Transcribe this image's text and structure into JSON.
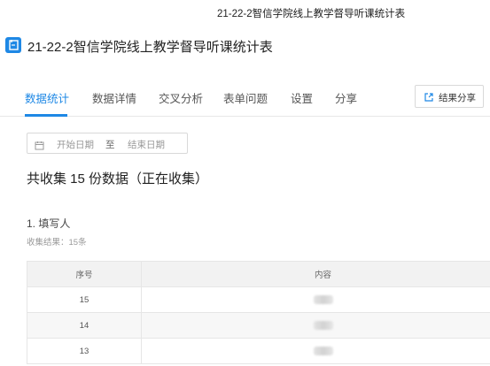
{
  "window": {
    "title": "21-22-2智信学院线上教学督导听课统计表"
  },
  "header": {
    "title": "21-22-2智信学院线上教学督导听课统计表",
    "icon": "form-icon"
  },
  "nav": {
    "tabs": [
      {
        "label": "数据统计",
        "active": true
      },
      {
        "label": "数据详情",
        "active": false
      },
      {
        "label": "交叉分析",
        "active": false
      },
      {
        "label": "表单问题",
        "active": false
      },
      {
        "label": "设置",
        "active": false
      },
      {
        "label": "分享",
        "active": false
      }
    ],
    "share_button": {
      "label": "结果分享",
      "icon": "share-icon"
    }
  },
  "filter": {
    "start_placeholder": "开始日期",
    "separator": "至",
    "end_placeholder": "结束日期",
    "icon": "calendar-icon"
  },
  "summary": "共收集 15 份数据（正在收集）",
  "question": {
    "title": "1. 填写人",
    "result": "收集结果：15条",
    "table": {
      "headers": [
        "序号",
        "内容"
      ],
      "rows": [
        {
          "index": "15"
        },
        {
          "index": "14"
        },
        {
          "index": "13"
        }
      ]
    }
  },
  "colors": {
    "accent": "#1e88e5"
  }
}
